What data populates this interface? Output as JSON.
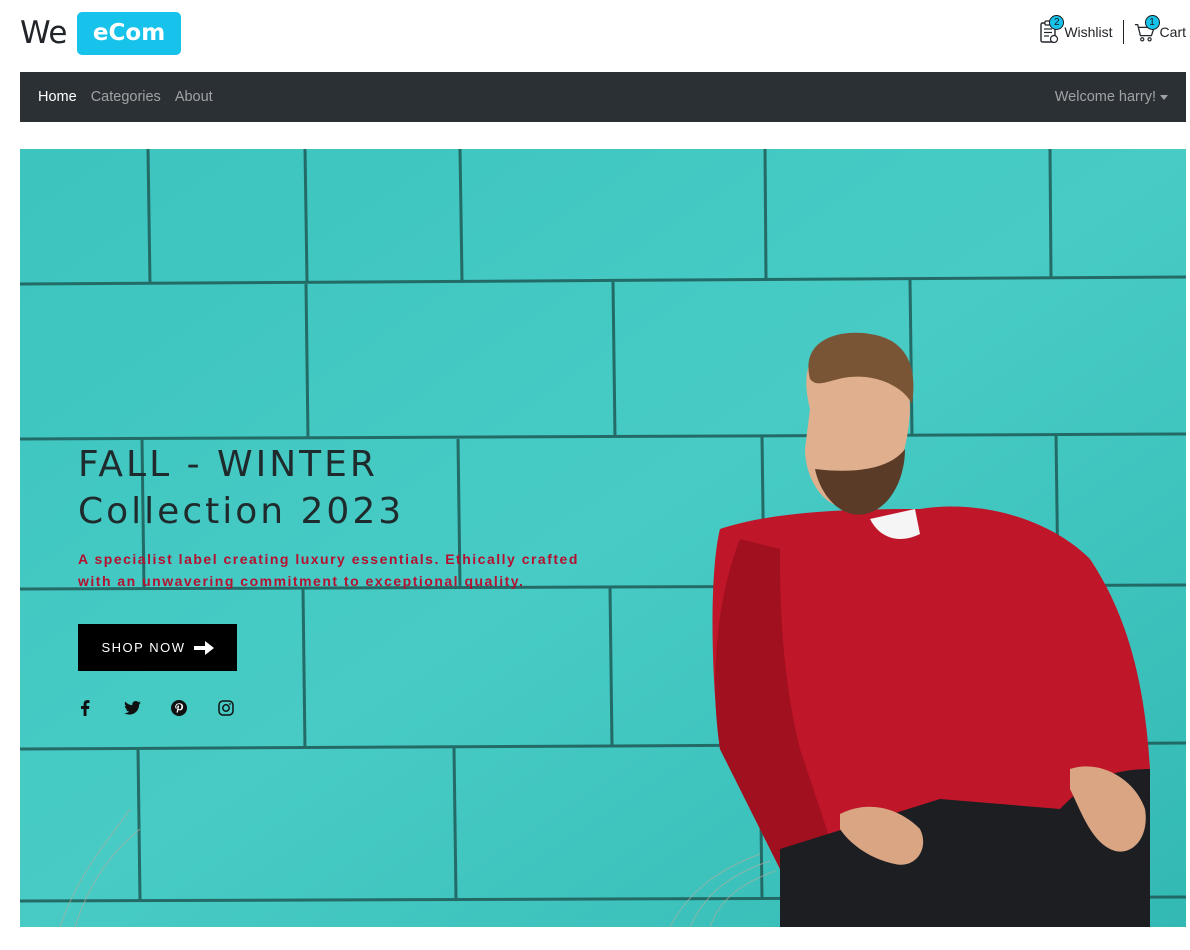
{
  "brand": {
    "we": "We",
    "ecom": "eCom",
    "accent": "#17c3ea"
  },
  "header": {
    "wishlist": {
      "label": "Wishlist",
      "count": "2",
      "icon": "wishlist-icon"
    },
    "cart": {
      "label": "Cart",
      "count": "1",
      "icon": "cart-icon"
    }
  },
  "navbar": {
    "items": [
      {
        "label": "Home",
        "active": true
      },
      {
        "label": "Categories",
        "active": false
      },
      {
        "label": "About",
        "active": false
      }
    ],
    "user_menu": "Welcome harry!",
    "background": "#2b3035"
  },
  "hero": {
    "title_line1": "FALL - WINTER",
    "title_line2": "Collection 2023",
    "subtitle": "A specialist label creating luxury essentials. Ethically crafted with an unwavering commitment to exceptional quality.",
    "button": "SHOP NOW",
    "socials": [
      "facebook-icon",
      "twitter-icon",
      "pinterest-icon",
      "instagram-icon"
    ],
    "wall_color": "#3fc7c2",
    "subtitle_color": "#b5102f"
  }
}
